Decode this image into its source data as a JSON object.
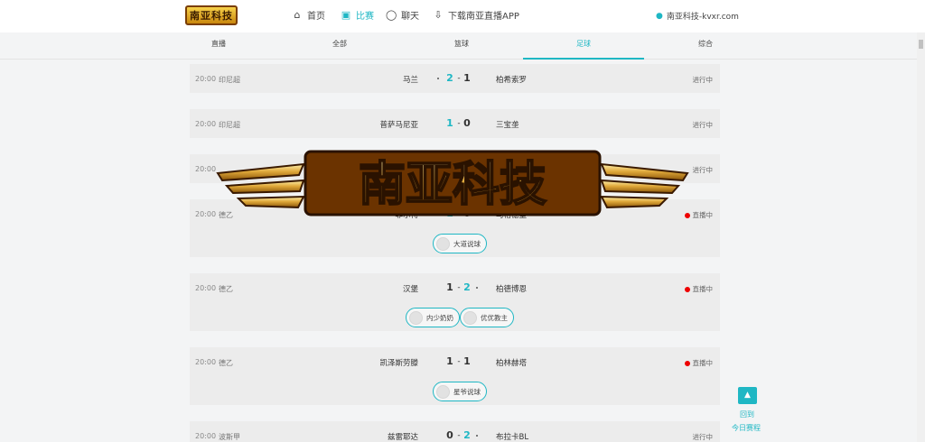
{
  "header": {
    "logo_text": "南亚科技",
    "nav": [
      {
        "icon": "home-icon",
        "label": "首页"
      },
      {
        "icon": "calendar-icon",
        "label": "比赛",
        "active": true
      },
      {
        "icon": "chat-icon",
        "label": "聊天"
      },
      {
        "icon": "download-icon",
        "label": "下载南亚直播APP"
      }
    ],
    "user_label": "南亚科技-kvxr.com"
  },
  "tabs": [
    "直播",
    "全部",
    "篮球",
    "足球",
    "综合"
  ],
  "active_tab": "足球",
  "matches": [
    {
      "time": "20:00",
      "league": "印尼超",
      "home": "马兰",
      "home_score": "2",
      "away_score": "1",
      "away": "柏希索罗",
      "status": "进行中",
      "lead": "home"
    },
    {
      "time": "20:00",
      "league": "印尼超",
      "home": "普萨马尼亚",
      "home_score": "1",
      "away_score": "0",
      "away": "三宝垄",
      "status": "进行中",
      "lead": "home"
    },
    {
      "time": "20:00",
      "league": "",
      "home": "",
      "home_score": "",
      "away_score": "",
      "away": "",
      "status": "进行中",
      "lead": "none"
    },
    {
      "time": "20:00",
      "league": "德乙",
      "home": "菲尔特",
      "home_score": "1",
      "away_score": "0",
      "away": "马格德堡",
      "status": "直播中",
      "lead": "home",
      "live": true,
      "streamers": [
        "大道说球"
      ]
    },
    {
      "time": "20:00",
      "league": "德乙",
      "home": "汉堡",
      "home_score": "1",
      "away_score": "2",
      "away": "柏德博恩",
      "status": "直播中",
      "lead": "away",
      "live": true,
      "streamers": [
        "内少奶奶",
        "优优教主"
      ]
    },
    {
      "time": "20:00",
      "league": "德乙",
      "home": "凯泽斯劳滕",
      "home_score": "1",
      "away_score": "1",
      "away": "柏林赫塔",
      "status": "直播中",
      "lead": "none",
      "live": true,
      "streamers": [
        "星爷说球"
      ]
    },
    {
      "time": "20:00",
      "league": "波斯甲",
      "home": "兹雷耶达",
      "home_score": "0",
      "away_score": "2",
      "away": "布拉卡BL",
      "status": "进行中",
      "lead": "away"
    }
  ],
  "watermark": "南亚科技",
  "back_to_schedule": {
    "line1": "回到",
    "line2": "今日赛程"
  }
}
